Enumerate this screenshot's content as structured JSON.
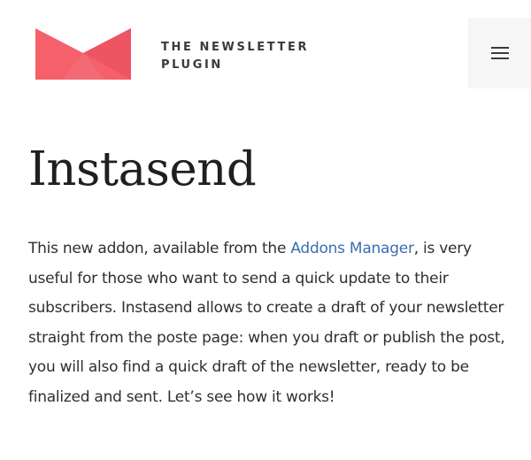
{
  "header": {
    "logo_icon": "envelope-logo-icon",
    "logo_line1": "THE NEWSLETTER",
    "logo_line2": "PLUGIN",
    "menu_icon": "hamburger-menu-icon",
    "brand_color": "#f5606a",
    "brand_color_dark": "#e84f5b"
  },
  "article": {
    "title": "Instasend",
    "intro_before_link": "This new addon, available from the ",
    "link_text": "Addons Manager",
    "intro_after_link": ", is very useful for those who want to send a quick update to their subscribers. Instasend allows to create a draft of your newsletter straight from the poste page: when you draft or publish the post, you will also find a quick draft of the newsletter, ready to be finalized and sent. Let’s see how it works!",
    "link_color": "#3a6fb0"
  }
}
